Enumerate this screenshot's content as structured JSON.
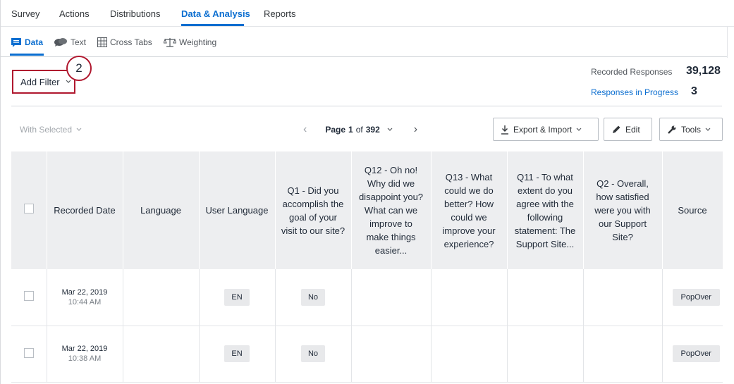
{
  "top_tabs": [
    {
      "label": "Survey",
      "active": false
    },
    {
      "label": "Actions",
      "active": false
    },
    {
      "label": "Distributions",
      "active": false
    },
    {
      "label": "Data & Analysis",
      "active": true
    },
    {
      "label": "Reports",
      "active": false
    }
  ],
  "sub_tabs": [
    {
      "label": "Data",
      "icon": "chat-bubble-icon",
      "active": true
    },
    {
      "label": "Text",
      "icon": "speech-bubbles-icon",
      "active": false
    },
    {
      "label": "Cross Tabs",
      "icon": "grid-icon",
      "active": false
    },
    {
      "label": "Weighting",
      "icon": "scale-icon",
      "active": false
    }
  ],
  "filter": {
    "label": "Add Filter",
    "callout_number": "2"
  },
  "stats": {
    "recorded_label": "Recorded Responses",
    "recorded_value": "39,128",
    "in_progress_label": "Responses in Progress",
    "in_progress_value": "3"
  },
  "toolbar": {
    "with_selected": "With Selected",
    "page_prefix": "Page",
    "page_current": "1",
    "page_of": "of",
    "page_total": "392",
    "export_label": "Export & Import",
    "edit_label": "Edit",
    "tools_label": "Tools"
  },
  "table": {
    "headers": [
      "",
      "Recorded Date",
      "Language",
      "User Language",
      "Q1 - Did you accomplish the goal of your visit to our site?",
      "Q12 - Oh no! Why did we disappoint you? What can we improve to make things easier...",
      "Q13 - What could we do better? How could we improve your experience?",
      "Q11 - To what extent do you agree with the following statement: The Support Site...",
      "Q2 - Overall, how satisfied were you with our Support Site?",
      "Source"
    ],
    "rows": [
      {
        "date": "Mar 22, 2019",
        "time": "10:44 AM",
        "language": "",
        "user_language": "EN",
        "q1": "No",
        "q12": "",
        "q13": "",
        "q11": "",
        "q2": "",
        "source": "PopOver"
      },
      {
        "date": "Mar 22, 2019",
        "time": "10:38 AM",
        "language": "",
        "user_language": "EN",
        "q1": "No",
        "q12": "",
        "q13": "",
        "q11": "",
        "q2": "",
        "source": "PopOver"
      }
    ]
  }
}
